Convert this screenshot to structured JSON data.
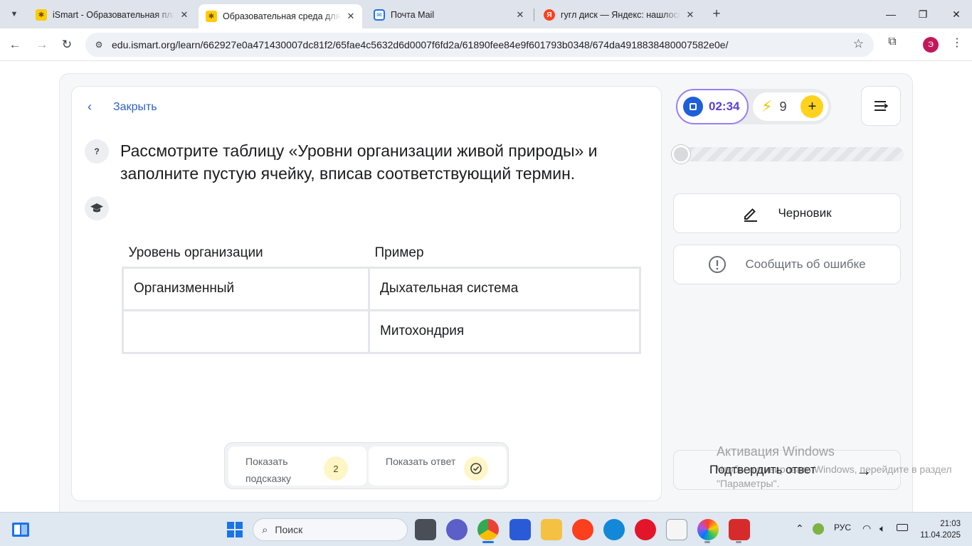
{
  "browser": {
    "tabs": [
      {
        "title": "iSmart - Образовательная пла",
        "favicon": "ismart-icon",
        "active": false
      },
      {
        "title": "Образовательная среда для с",
        "favicon": "ismart-icon",
        "active": true
      },
      {
        "title": "Почта Mail",
        "favicon": "mail-icon",
        "active": false
      },
      {
        "title": "гугл диск — Яндекс: нашлось",
        "favicon": "yandex-icon",
        "active": false
      }
    ],
    "favicon_letters": {
      "mail": "✉",
      "yandex": "Я",
      "ismart": "✱"
    },
    "url": "edu.ismart.org/learn/662927e0a471430007dc81f2/65fae4c5632d6d0007f6fd2a/61890fee84e9f601793b0348/674da4918838480007582e0e/",
    "profile_letter": "Э"
  },
  "task": {
    "close_label": "Закрыть",
    "question_marker": "?",
    "question": "Рассмотрите таблицу «Уровни организации живой природы» и заполните пустую ячейку, вписав соответствующий термин.",
    "table": {
      "headers": [
        "Уровень организации",
        "Пример"
      ],
      "rows": [
        [
          "Организменный",
          "Дыхательная система"
        ],
        [
          "",
          "Митохондрия"
        ]
      ]
    },
    "hint_button": {
      "label": "Показать подсказку",
      "count": "2"
    },
    "answer_button": {
      "label": "Показать ответ"
    }
  },
  "side": {
    "timer": "02:34",
    "energy": "9",
    "progress_fraction": 0.0,
    "draft_label": "Черновик",
    "report_label": "Сообщить об ошибке",
    "submit_label": "Подтвердить ответ",
    "accent_color": "#5b40d6"
  },
  "watermark": {
    "title": "Активация Windows",
    "text": "Чтобы активировать Windows, перейдите в раздел \"Параметры\"."
  },
  "taskbar": {
    "search_placeholder": "Поиск",
    "language": "РУС",
    "time": "21:03",
    "date": "11.04.2025"
  }
}
